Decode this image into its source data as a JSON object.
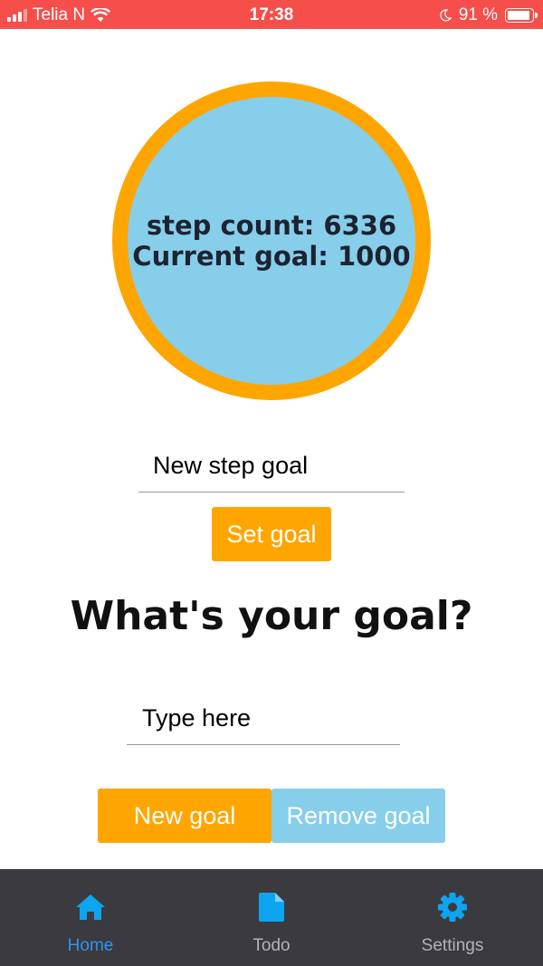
{
  "status": {
    "carrier": "Telia N",
    "time": "17:38",
    "battery": "91 %",
    "battery_level": 0.91
  },
  "step_display": {
    "step_count_text": "step count: 6336",
    "current_goal_text": "Current goal: 1000"
  },
  "goal_form": {
    "placeholder": "New step goal",
    "set_label": "Set goal"
  },
  "heading": "What's your goal?",
  "todo_form": {
    "placeholder": "Type here",
    "new_label": "New goal",
    "remove_label": "Remove goal"
  },
  "tabs": [
    {
      "label": "Home",
      "icon": "home-icon",
      "active": true
    },
    {
      "label": "Todo",
      "icon": "document-icon",
      "active": false
    },
    {
      "label": "Settings",
      "icon": "gear-icon",
      "active": false
    }
  ],
  "colors": {
    "status_bar": "#f64e4b",
    "accent_orange": "#ffa500",
    "accent_blue": "#87ceeb",
    "tab_bar": "#3b3a3f",
    "tab_active": "#2b95f3",
    "tab_icon": "#0ea5f0",
    "tab_inactive_label": "#b4b4b8"
  }
}
